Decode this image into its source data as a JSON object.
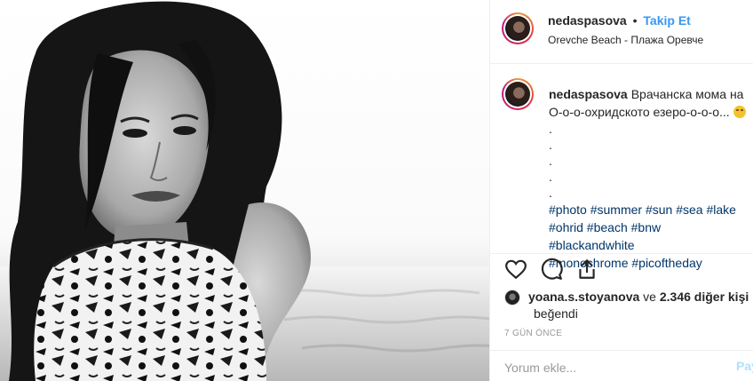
{
  "post": {
    "author": "nedaspasova",
    "follow_label": "Takip Et",
    "separator": "•",
    "location": "Orevche Beach - Плажа Оревче",
    "image_alt": "Black and white portrait photo"
  },
  "caption": {
    "author": "nedaspasova",
    "text": "Врачанска мома на О-о-о-охридското езеро-о-о-о...",
    "dots": [
      ".",
      ".",
      ".",
      ".",
      "."
    ],
    "hashtags_line1": "#photo #summer #sun #sea #lake",
    "hashtags_line2": "#ohrid #beach #bnw #blackandwhite",
    "hashtags_line3": "#monochrome #picoftheday"
  },
  "actions": {
    "like_icon": "heart-icon",
    "comment_icon": "comment-icon",
    "share_icon": "share-icon"
  },
  "likes": {
    "user": "yoana.s.stoyanova",
    "connector": "ve",
    "others": "2.346 diğer kişi",
    "liked_label": "beğendi"
  },
  "timestamp": "7 GÜN ÖNCE",
  "comment": {
    "placeholder": "Yorum ekle...",
    "post_label": "Paylaş"
  },
  "colors": {
    "link_blue": "#3897f0",
    "hashtag": "#003569",
    "border": "#efefef"
  }
}
